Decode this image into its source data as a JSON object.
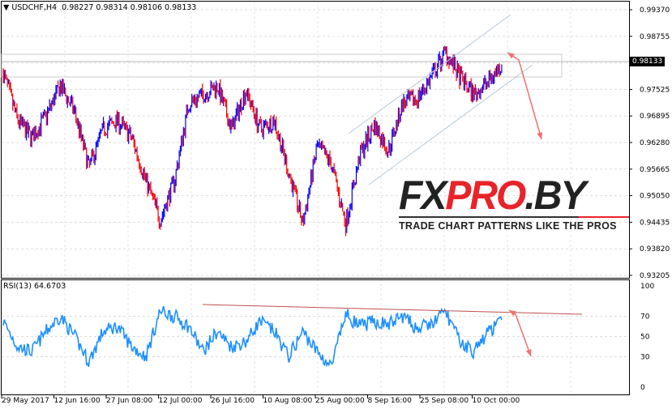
{
  "header": {
    "title": "USDCHF,H4",
    "ohlc": "0.98227 0.98314 0.98106 0.98133"
  },
  "price_axis": {
    "labels": [
      "0.99370",
      "0.98755",
      "0.98133",
      "0.97525",
      "0.96895",
      "0.96280",
      "0.95665",
      "0.95050",
      "0.94435",
      "0.93820",
      "0.93205"
    ],
    "current": "0.98133"
  },
  "rsi": {
    "label": "RSI(13) 64.6703",
    "levels": [
      "100",
      "70",
      "50",
      "30",
      "0"
    ]
  },
  "time_axis": [
    "29 May 2017",
    "12 Jun 16:00",
    "27 Jun 08:00",
    "12 Jul 00:00",
    "26 Jul 16:00",
    "10 Aug 08:00",
    "25 Aug 00:00",
    "8 Sep 16:00",
    "25 Sep 08:00",
    "10 Oct 00:00"
  ],
  "logo": {
    "part1": "FX",
    "part2": "PRO",
    "part3": ".BY",
    "tagline": "TRADE CHART PATTERNS LIKE THE PROS"
  },
  "colors": {
    "bull": "#0000ff",
    "bear": "#ff0000",
    "rsi": "#1e90ff",
    "arrow": "#f07070",
    "channel": "#b8c8d8"
  },
  "chart_data": {
    "type": "line",
    "title": "USDCHF,H4",
    "ylim": [
      0.93205,
      0.9937
    ],
    "price_path": [
      0.979,
      0.968,
      0.964,
      0.969,
      0.976,
      0.97,
      0.957,
      0.966,
      0.968,
      0.964,
      0.954,
      0.945,
      0.954,
      0.972,
      0.974,
      0.976,
      0.966,
      0.975,
      0.966,
      0.968,
      0.956,
      0.944,
      0.962,
      0.958,
      0.944,
      0.96,
      0.967,
      0.961,
      0.972,
      0.973,
      0.978,
      0.984,
      0.978,
      0.974,
      0.977,
      0.9813
    ],
    "rsi_path": [
      65,
      40,
      35,
      55,
      70,
      50,
      25,
      55,
      60,
      40,
      30,
      75,
      70,
      60,
      35,
      55,
      40,
      45,
      65,
      55,
      30,
      55,
      35,
      20,
      72,
      60,
      65,
      62,
      70,
      58,
      62,
      75,
      45,
      35,
      55,
      65
    ]
  }
}
